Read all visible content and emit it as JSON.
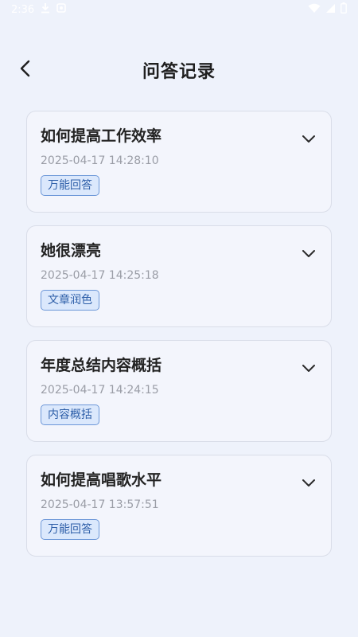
{
  "status_bar": {
    "time": "2:36",
    "left_icons": [
      "download-icon",
      "sync-icon"
    ],
    "right_icons": [
      "wifi-icon",
      "signal-icon",
      "battery-icon"
    ]
  },
  "header": {
    "title": "问答记录",
    "back_icon": "back-arrow-icon"
  },
  "records": [
    {
      "title": "如何提高工作效率",
      "time": "2025-04-17 14:28:10",
      "tag": "万能回答"
    },
    {
      "title": "她很漂亮",
      "time": "2025-04-17 14:25:18",
      "tag": "文章润色"
    },
    {
      "title": "年度总结内容概括",
      "time": "2025-04-17 14:24:15",
      "tag": "内容概括"
    },
    {
      "title": "如何提高唱歌水平",
      "time": "2025-04-17 13:57:51",
      "tag": "万能回答"
    }
  ],
  "colors": {
    "background": "#eef2fb",
    "card_background": "#f3f5fc",
    "card_border": "#d9dde8",
    "tag_background": "#dbe8fc",
    "tag_border": "#6c97d8",
    "tag_text": "#2d5ea8",
    "time_text": "#9a9da6"
  }
}
